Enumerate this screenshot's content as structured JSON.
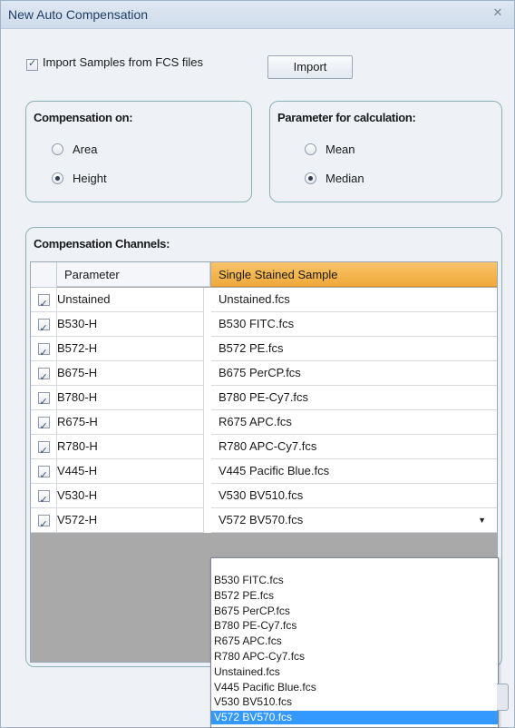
{
  "window": {
    "title": "New Auto Compensation"
  },
  "import": {
    "checkbox_label": "Import Samples from FCS files",
    "checked": true,
    "button_label": "Import"
  },
  "compensation_on": {
    "title": "Compensation on:",
    "options": [
      {
        "label": "Area",
        "selected": false
      },
      {
        "label": "Height",
        "selected": true
      }
    ]
  },
  "parameter_for_calculation": {
    "title": "Parameter for calculation:",
    "options": [
      {
        "label": "Mean",
        "selected": false
      },
      {
        "label": "Median",
        "selected": true
      }
    ]
  },
  "channels": {
    "title": "Compensation Channels:",
    "headers": {
      "parameter": "Parameter",
      "sample": "Single Stained Sample"
    },
    "rows": [
      {
        "checked": true,
        "parameter": "Unstained",
        "sample": "Unstained.fcs"
      },
      {
        "checked": true,
        "parameter": "B530-H",
        "sample": "B530 FITC.fcs"
      },
      {
        "checked": true,
        "parameter": "B572-H",
        "sample": "B572 PE.fcs"
      },
      {
        "checked": true,
        "parameter": "B675-H",
        "sample": "B675 PerCP.fcs"
      },
      {
        "checked": true,
        "parameter": "B780-H",
        "sample": "B780 PE-Cy7.fcs"
      },
      {
        "checked": true,
        "parameter": "R675-H",
        "sample": "R675 APC.fcs"
      },
      {
        "checked": true,
        "parameter": "R780-H",
        "sample": "R780 APC-Cy7.fcs"
      },
      {
        "checked": true,
        "parameter": "V445-H",
        "sample": "V445 Pacific Blue.fcs"
      },
      {
        "checked": true,
        "parameter": "V530-H",
        "sample": "V530 BV510.fcs"
      },
      {
        "checked": true,
        "parameter": "V572-H",
        "sample": "V572 BV570.fcs"
      }
    ]
  },
  "dropdown": {
    "options": [
      "B530 FITC.fcs",
      "B572 PE.fcs",
      "B675 PerCP.fcs",
      "B780 PE-Cy7.fcs",
      "R675 APC.fcs",
      "R780 APC-Cy7.fcs",
      "Unstained.fcs",
      "V445 Pacific Blue.fcs",
      "V530 BV510.fcs",
      "V572 BV570.fcs"
    ],
    "selected": "V572 BV570.fcs"
  },
  "colors": {
    "header_accent": "#f0a93a",
    "selection": "#3399ff",
    "group_border": "#8ab1b7"
  }
}
